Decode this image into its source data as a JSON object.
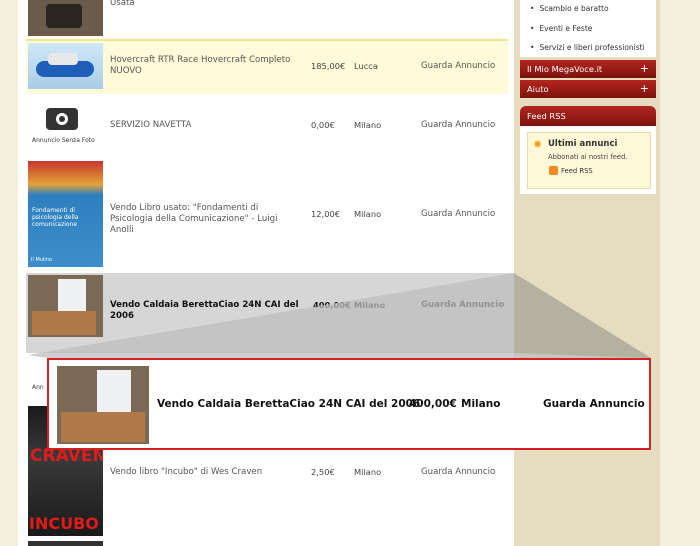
{
  "listings": [
    {
      "title": "Usata",
      "price": "",
      "city": "",
      "link": ""
    },
    {
      "title": "Hovercraft RTR Race Hovercraft Completo NUOVO",
      "price": "185,00€",
      "city": "Lucca",
      "link": "Guarda Annuncio"
    },
    {
      "title": "SERVIZIO NAVETTA",
      "price": "0,00€",
      "city": "Milano",
      "link": "Guarda Annuncio",
      "thumb_caption": "Annuncio Senza Foto"
    },
    {
      "title": "Vendo Libro usato: \"Fondamenti di Psicologia della Comunicazione\" - Luigi Anolli",
      "price": "12,00€",
      "city": "Milano",
      "link": "Guarda Annuncio",
      "book_title": "Fondamenti di psicologia della comunicazione",
      "book_publisher": "Il Mulino"
    },
    {
      "title": "Vendo Caldaia BerettaCiao 24N CAI del 2006",
      "price": "400,00€",
      "city": "Milano",
      "link": "Guarda Annuncio"
    },
    {
      "title": "Vendo libro \"Incubo\" di Wes Craven",
      "price": "2,50€",
      "city": "Milano",
      "link": "Guarda Annuncio",
      "cover_top": "CRAVEN",
      "cover_bottom": "INCUBO"
    }
  ],
  "partial_thumb_caption": "Ann",
  "sidebar": {
    "links": [
      "Scambio e baratto",
      "Eventi e Feste",
      "Servizi e liberi professionisti"
    ],
    "menus": [
      "Il Mio MegaVoce.it",
      "Aiuto"
    ],
    "menu_plus": "+",
    "feed_header": "Feed RSS",
    "feed_title": "Ultimi annunci",
    "feed_sub": "Abbonati ai nostri feed.",
    "feed_link": "Feed RSS"
  },
  "callout": {
    "title": "Vendo Caldaia BerettaCiao 24N CAI del 2006",
    "price": "400,00€",
    "city": "Milano",
    "link": "Guarda Annuncio"
  },
  "colors": {
    "highlight_row": "#fffbd8",
    "selected_row": "#d6d6d6",
    "callout_border": "#d42020",
    "menu_red": "#9a1c15"
  }
}
